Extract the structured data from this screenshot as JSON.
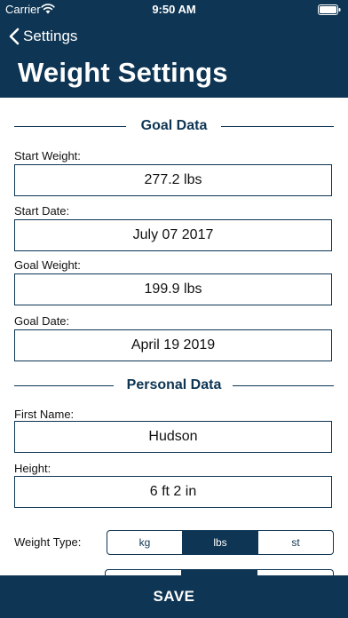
{
  "status_bar": {
    "carrier": "Carrier",
    "time": "9:50 AM"
  },
  "nav": {
    "back_label": "Settings",
    "title": "Weight Settings"
  },
  "goal_section": {
    "heading": "Goal Data",
    "fields": [
      {
        "label": "Start Weight:",
        "value": "277.2 lbs"
      },
      {
        "label": "Start Date:",
        "value": "July 07 2017"
      },
      {
        "label": "Goal Weight:",
        "value": "199.9 lbs"
      },
      {
        "label": "Goal Date:",
        "value": "April 19 2019"
      }
    ]
  },
  "personal_section": {
    "heading": "Personal Data",
    "fields": [
      {
        "label": "First Name:",
        "value": "Hudson"
      },
      {
        "label": "Height:",
        "value": "6 ft 2 in"
      }
    ]
  },
  "weight_type": {
    "label": "Weight Type:",
    "options": [
      "kg",
      "lbs",
      "st"
    ],
    "selected": "lbs"
  },
  "save_label": "SAVE",
  "colors": {
    "primary": "#0e3553",
    "background": "#ffffff"
  },
  "icons": {
    "back": "chevron-left-icon",
    "wifi": "wifi-icon",
    "battery": "battery-icon"
  }
}
